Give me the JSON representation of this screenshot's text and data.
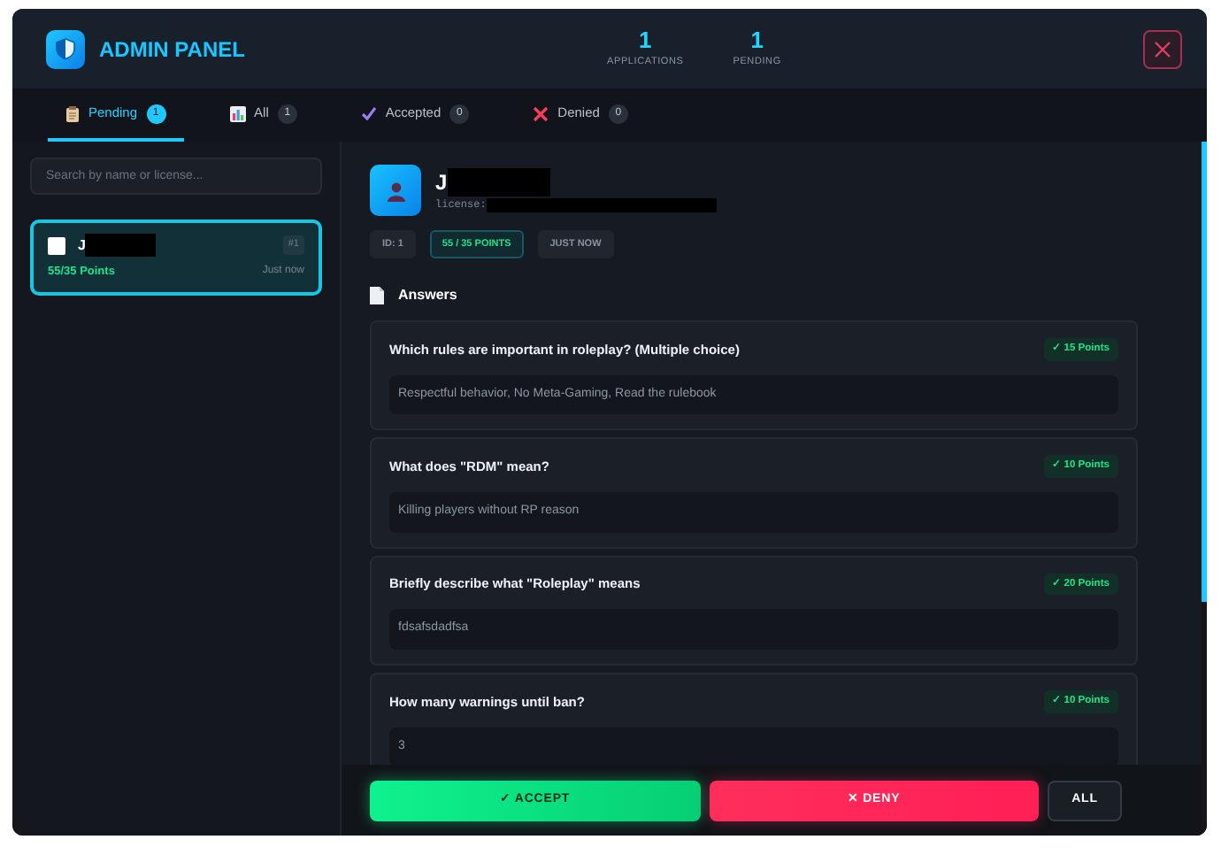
{
  "header": {
    "title": "ADMIN PANEL",
    "stats": [
      {
        "value": "1",
        "label": "APPLICATIONS"
      },
      {
        "value": "1",
        "label": "PENDING"
      }
    ]
  },
  "tabs": [
    {
      "label": "Pending",
      "count": "1",
      "kind": "pending",
      "selected": true
    },
    {
      "label": "All",
      "count": "1",
      "kind": "all",
      "selected": false
    },
    {
      "label": "Accepted",
      "count": "0",
      "kind": "accepted",
      "selected": false
    },
    {
      "label": "Denied",
      "count": "0",
      "kind": "denied",
      "selected": false
    }
  ],
  "sidebar": {
    "search": {
      "placeholder": "Search by name or license..."
    },
    "items": [
      {
        "name": "J",
        "number": "#1",
        "points": "55/35 Points",
        "time": "Just now",
        "checked": false,
        "selected": true
      }
    ]
  },
  "detail": {
    "name": "J",
    "license_label": "license:",
    "tags": [
      {
        "text": "ID: 1",
        "kind": "plain"
      },
      {
        "text": "55 / 35 POINTS",
        "kind": "points"
      },
      {
        "text": "JUST NOW",
        "kind": "plain"
      }
    ],
    "answers_title": "Answers",
    "answers": [
      {
        "question": "Which rules are important in roleplay? (Multiple choice)",
        "points": "✓ 15 Points",
        "answer": "Respectful behavior, No Meta-Gaming, Read the rulebook"
      },
      {
        "question": "What does \"RDM\" mean?",
        "points": "✓ 10 Points",
        "answer": "Killing players without RP reason"
      },
      {
        "question": "Briefly describe what \"Roleplay\" means",
        "points": "✓ 20 Points",
        "answer": "fdsafsdadfsa"
      },
      {
        "question": "How many warnings until ban?",
        "points": "✓ 10 Points",
        "answer": "3"
      }
    ]
  },
  "actions": [
    {
      "label": "✓ ACCEPT",
      "kind": "accept"
    },
    {
      "label": "✕ DENY",
      "kind": "deny"
    },
    {
      "label": "ALL",
      "kind": "neutral"
    }
  ]
}
